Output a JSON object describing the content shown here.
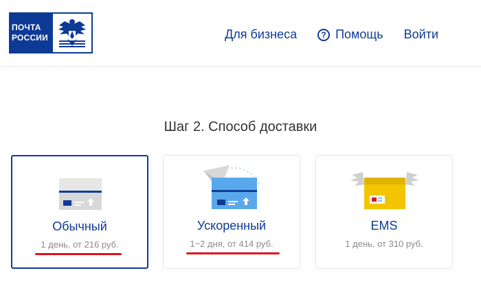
{
  "header": {
    "logo_text": [
      "ПОЧТА",
      "РОССИИ"
    ],
    "nav": {
      "business": "Для бизнеса",
      "help": "Помощь",
      "login": "Войти"
    },
    "help_icon_glyph": "?"
  },
  "step_title": "Шаг 2. Способ доставки",
  "delivery_options": [
    {
      "name": "Обычный",
      "desc": "1 день, от 216 руб.",
      "selected": true,
      "icon": "standard-parcel-icon"
    },
    {
      "name": "Ускоренный",
      "desc": "1−2 дня, от 414 руб.",
      "selected": false,
      "icon": "express-parcel-icon"
    },
    {
      "name": "EMS",
      "desc": "1 день, от 310 руб.",
      "selected": false,
      "icon": "ems-box-icon"
    }
  ],
  "colors": {
    "brand_blue": "#0d3a95",
    "underline_red": "#e0101c",
    "ems_yellow": "#f2c500"
  }
}
